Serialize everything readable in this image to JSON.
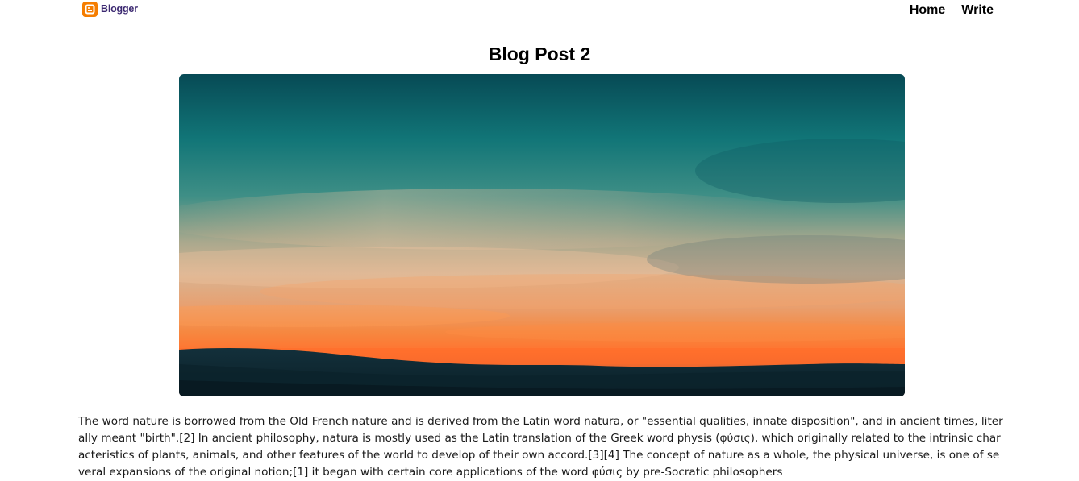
{
  "navbar": {
    "logo_text": "Blogger",
    "links": [
      {
        "label": "Home"
      },
      {
        "label": "Write"
      }
    ]
  },
  "post": {
    "title": "Blog Post 2",
    "image": {
      "description": "",
      "colors": {
        "sky_top": "#0a4f58",
        "sky_teal": "#1f8a8a",
        "haze": "#c9b497",
        "orange": "#f28a3a",
        "horizon": "#ff6a2a",
        "ground": "#0e2a33"
      }
    },
    "body": "The word nature is borrowed from the Old French nature and is derived from the Latin word natura, or \"essential qualities, innate disposition\", and in ancient times, literally meant \"birth\".[2] In ancient philosophy, natura is mostly used as the Latin translation of the Greek word physis (φύσις), which originally related to the intrinsic characteristics of plants, animals, and other features of the world to develop of their own accord.[3][4] The concept of nature as a whole, the physical universe, is one of several expansions of the original notion;[1] it began with certain core applications of the word φύσις by pre-Socratic philosophers"
  }
}
